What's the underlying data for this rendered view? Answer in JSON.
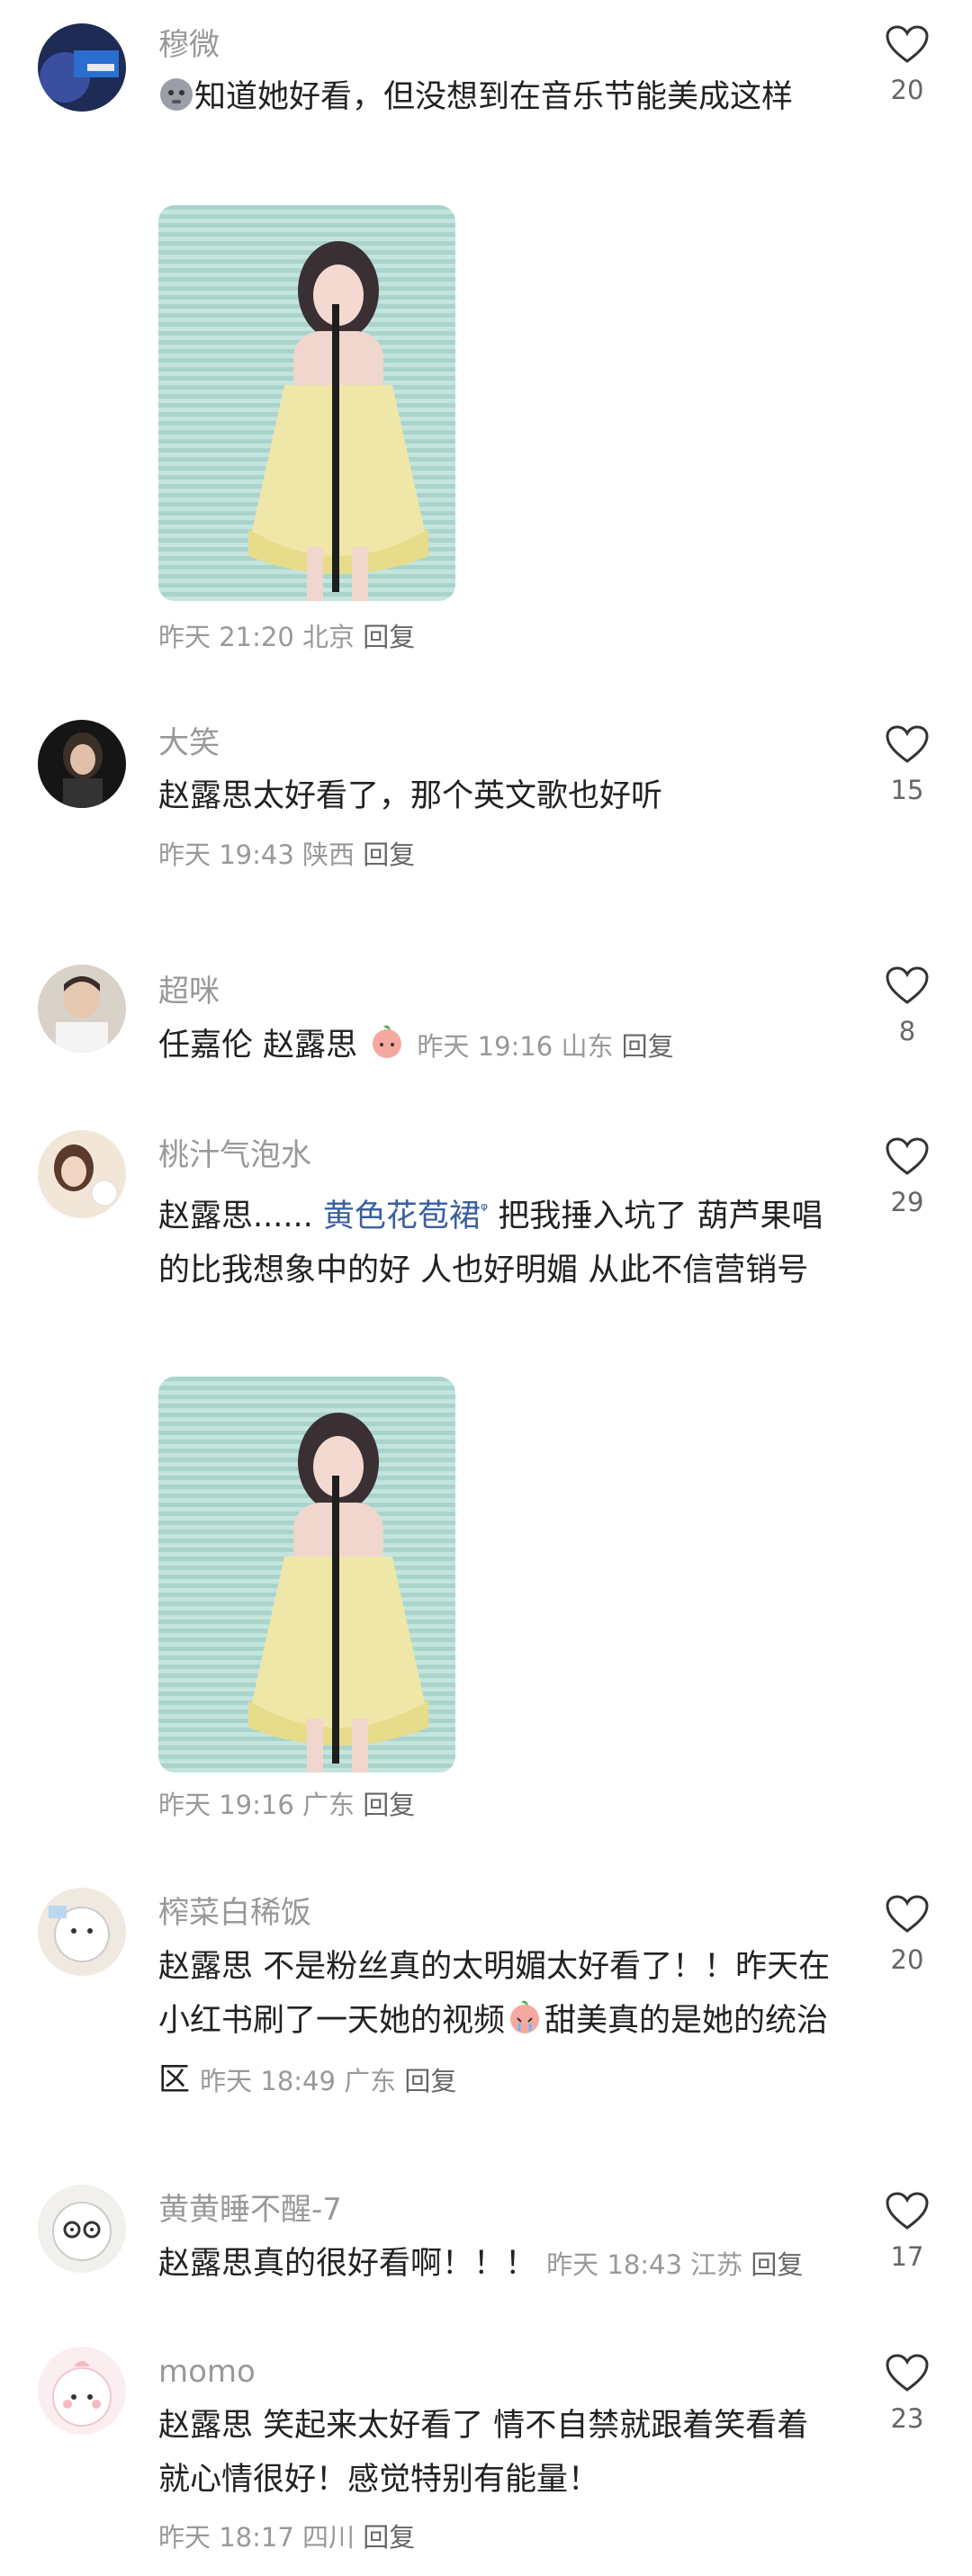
{
  "comments": [
    {
      "user": "穆微",
      "text": "知道她好看，但没想到在音乐节能美成这样",
      "time": "昨天 21:20",
      "location": "北京",
      "reply": "回复",
      "likes": "20"
    },
    {
      "user": "大笑",
      "text": "赵露思太好看了，那个英文歌也好听",
      "time": "昨天 19:43",
      "location": "陕西",
      "reply": "回复",
      "likes": "15"
    },
    {
      "user": "超咪",
      "text": "任嘉伦 赵露思",
      "time": "昨天 19:16",
      "location": "山东",
      "reply": "回复",
      "likes": "8"
    },
    {
      "user": "桃汁气泡水",
      "text_before": "赵露思...... ",
      "mention": "黄色花苞裙",
      "text_after": " 把我捶入坑了 葫芦果唱的比我想象中的好 人也好明媚 从此不信营销号",
      "time": "昨天 19:16",
      "location": "广东",
      "reply": "回复",
      "likes": "29"
    },
    {
      "user": "榨菜白稀饭",
      "text_before": "赵露思 不是粉丝真的太明媚太好看了！！昨天在小红书刷了一天她的视频",
      "text_after": "甜美真的是她的统治区",
      "time": "昨天 18:49",
      "location": "广东",
      "reply": "回复",
      "likes": "20"
    },
    {
      "user": "黄黄睡不醒-7",
      "text": "赵露思真的很好看啊！！！",
      "time": "昨天 18:43",
      "location": "江苏",
      "reply": "回复",
      "likes": "17"
    },
    {
      "user": "momo",
      "text": "赵露思 笑起来太好看了 情不自禁就跟着笑看着就心情很好！感觉特别有能量！",
      "time": "昨天 18:17",
      "location": "四川",
      "reply": "回复",
      "likes": "23"
    }
  ],
  "icons": {
    "like": "heart-outline-icon",
    "search": "search-icon"
  },
  "colors": {
    "name": "#999999",
    "text": "#222222",
    "mention": "#3a5fa0"
  }
}
